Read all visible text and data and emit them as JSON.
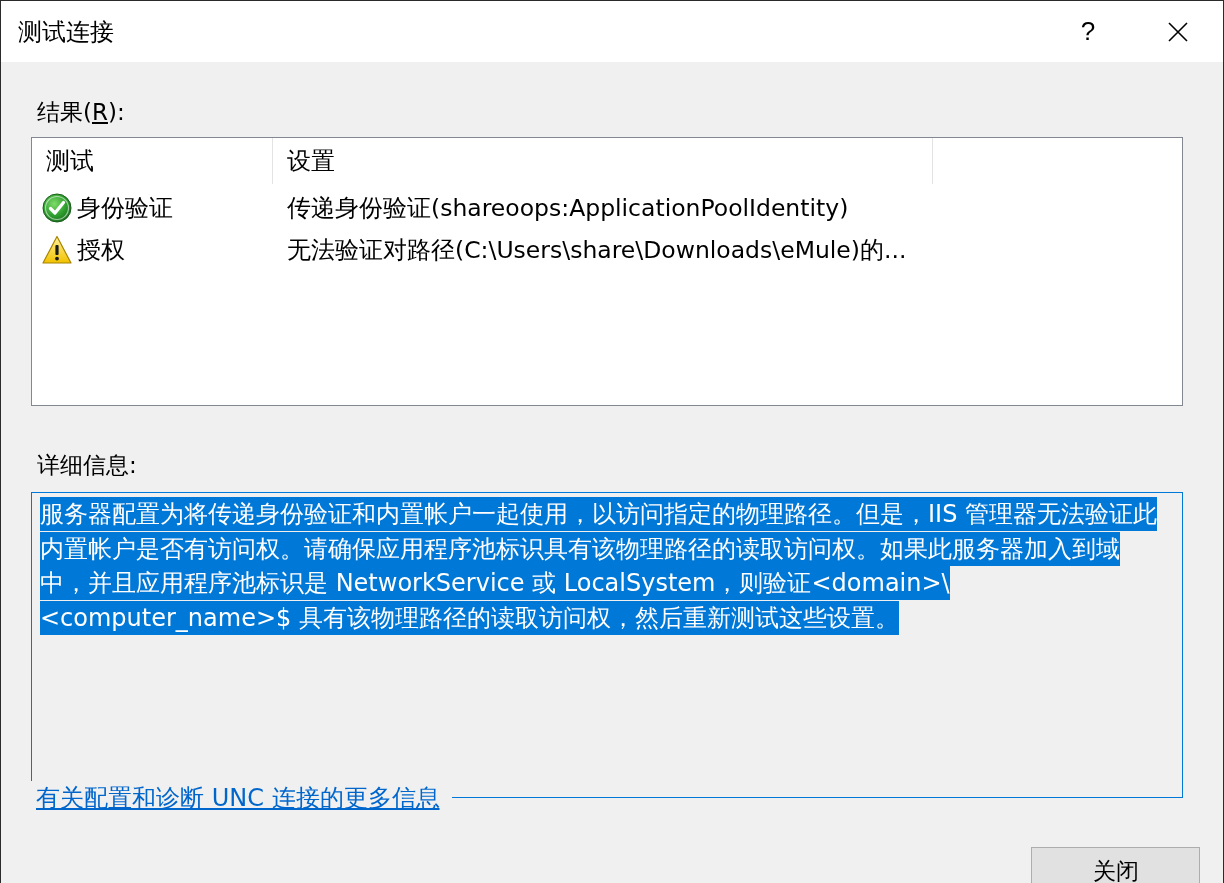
{
  "title_bar": {
    "title": "测试连接",
    "help_button": "?"
  },
  "results": {
    "label": {
      "before": "结果(",
      "access_key": "R",
      "after": "):"
    },
    "columns": [
      "测试",
      "设置"
    ],
    "rows": [
      {
        "kind": "success",
        "test": "身份验证",
        "setting": "传递身份验证(shareoops:ApplicationPoolIdentity)"
      },
      {
        "kind": "warning",
        "test": "授权",
        "setting": "无法验证对路径(C:\\Users\\share\\Downloads\\eMule)的..."
      }
    ]
  },
  "details": {
    "label": "详细信息:",
    "text": "服务器配置为将传递身份验证和内置帐户一起使用，以访问指定的物理路径。但是，IIS 管理器无法验证此内置帐户是否有访问权。请确保应用程序池标识具有该物理路径的读取访问权。如果此服务器加入到域中，并且应用程序池标识是 NetworkService 或 LocalSystem，则验证<domain>\\<computer_name>$ 具有该物理路径的读取访问权，然后重新测试这些设置。",
    "selected": true,
    "link": "有关配置和诊断 UNC 连接的更多信息"
  },
  "buttons": [
    "关闭"
  ]
}
